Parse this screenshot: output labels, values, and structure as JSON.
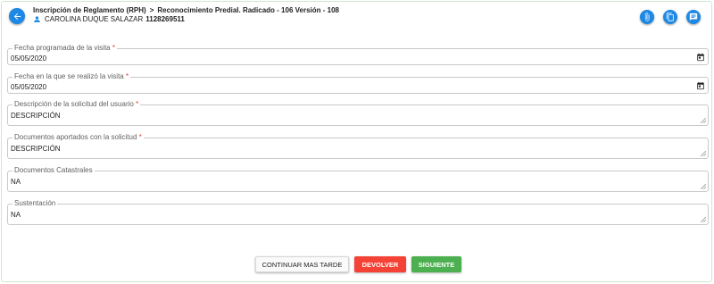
{
  "header": {
    "breadcrumb": {
      "parent": "Inscripción de Reglamento (RPH)",
      "current": "Reconocimiento Predial. Radicado - 106 Versión - 108"
    },
    "user": {
      "name": "CAROLINA DUQUE SALAZAR",
      "id": "1128269511"
    },
    "actions": [
      {
        "name": "attachment-button",
        "icon": "paperclip-icon"
      },
      {
        "name": "documents-button",
        "icon": "copy-document-icon"
      },
      {
        "name": "comments-button",
        "icon": "chat-icon"
      }
    ]
  },
  "form": {
    "fecha_programada": {
      "label": "Fecha programada de la visita",
      "required": "*",
      "value": "05/05/2020"
    },
    "fecha_realizada": {
      "label": "Fecha en la que se realizó la visita",
      "required": "*",
      "value": "05/05/2020"
    },
    "descripcion_solicitud": {
      "label": "Descripción de la solicitud del usuario",
      "required": "*",
      "value": "DESCRIPCIÓN"
    },
    "documentos_aportados": {
      "label": "Documentos aportados con la solicitud",
      "required": "*",
      "value": "DESCRIPCIÓN"
    },
    "documentos_catastrales": {
      "label": "Documentos Catastrales",
      "value": "NA"
    },
    "sustentacion": {
      "label": "Sustentación",
      "value": "NA"
    }
  },
  "buttons": {
    "continue_later": "CONTINUAR MAS TARDE",
    "return": "DEVOLVER",
    "next": "SIGUIENTE"
  },
  "colors": {
    "primary": "#1e88e5",
    "danger": "#f44336",
    "success": "#4caf50",
    "required": "#e53935"
  }
}
